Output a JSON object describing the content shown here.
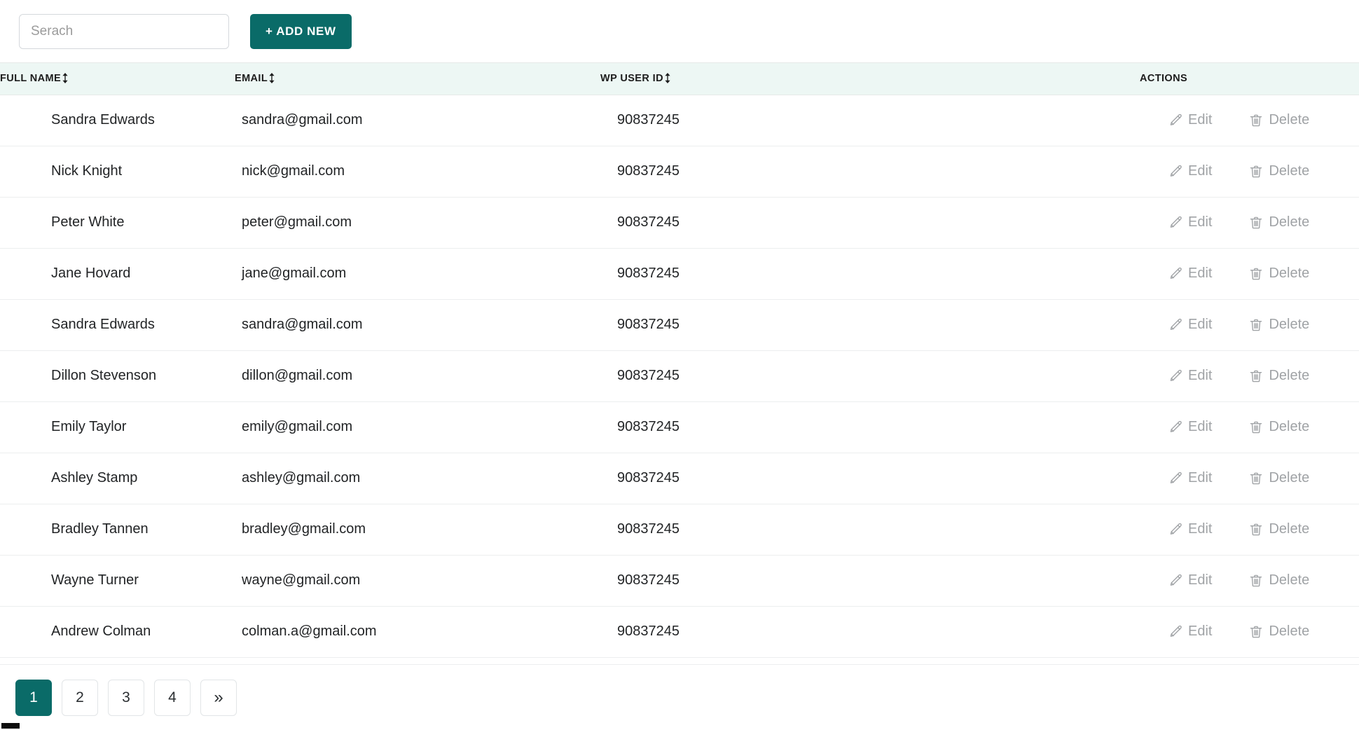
{
  "theme": {
    "accent": "#0a6b68",
    "header_row_bg": "#edf7f4",
    "row_border": "#eceeef",
    "action_text": "#a0a3a6"
  },
  "toolbar": {
    "search_placeholder": "Serach",
    "search_value": "",
    "add_new_label": "+ ADD NEW"
  },
  "table": {
    "columns": [
      {
        "key": "full_name",
        "label": "FULL NAME",
        "sortable": true,
        "sort_icon": "sort-updown-icon"
      },
      {
        "key": "email",
        "label": "EMAIL",
        "sortable": true,
        "sort_icon": "sort-updown-icon"
      },
      {
        "key": "wp_user_id",
        "label": "WP USER ID",
        "sortable": true,
        "sort_icon": "sort-updown-icon"
      },
      {
        "key": "actions",
        "label": "ACTIONS",
        "sortable": false,
        "sort_icon": ""
      }
    ],
    "row_actions": {
      "edit_label": "Edit",
      "edit_icon": "pencil-icon",
      "delete_label": "Delete",
      "delete_icon": "trash-icon"
    },
    "rows": [
      {
        "full_name": "Sandra Edwards",
        "email": "sandra@gmail.com",
        "wp_user_id": "90837245"
      },
      {
        "full_name": "Nick Knight",
        "email": "nick@gmail.com",
        "wp_user_id": "90837245"
      },
      {
        "full_name": "Peter White",
        "email": "peter@gmail.com",
        "wp_user_id": "90837245"
      },
      {
        "full_name": "Jane Hovard",
        "email": "jane@gmail.com",
        "wp_user_id": "90837245"
      },
      {
        "full_name": "Sandra Edwards",
        "email": "sandra@gmail.com",
        "wp_user_id": "90837245"
      },
      {
        "full_name": "Dillon Stevenson",
        "email": "dillon@gmail.com",
        "wp_user_id": "90837245"
      },
      {
        "full_name": "Emily Taylor",
        "email": "emily@gmail.com",
        "wp_user_id": "90837245"
      },
      {
        "full_name": "Ashley Stamp",
        "email": "ashley@gmail.com",
        "wp_user_id": "90837245"
      },
      {
        "full_name": "Bradley Tannen",
        "email": "bradley@gmail.com",
        "wp_user_id": "90837245"
      },
      {
        "full_name": "Wayne Turner",
        "email": "wayne@gmail.com",
        "wp_user_id": "90837245"
      },
      {
        "full_name": "Andrew Colman",
        "email": "colman.a@gmail.com",
        "wp_user_id": "90837245"
      }
    ]
  },
  "pagination": {
    "pages": [
      "1",
      "2",
      "3",
      "4"
    ],
    "active_page": "1",
    "next_label": "»",
    "next_icon": "double-chevron-right-icon"
  }
}
